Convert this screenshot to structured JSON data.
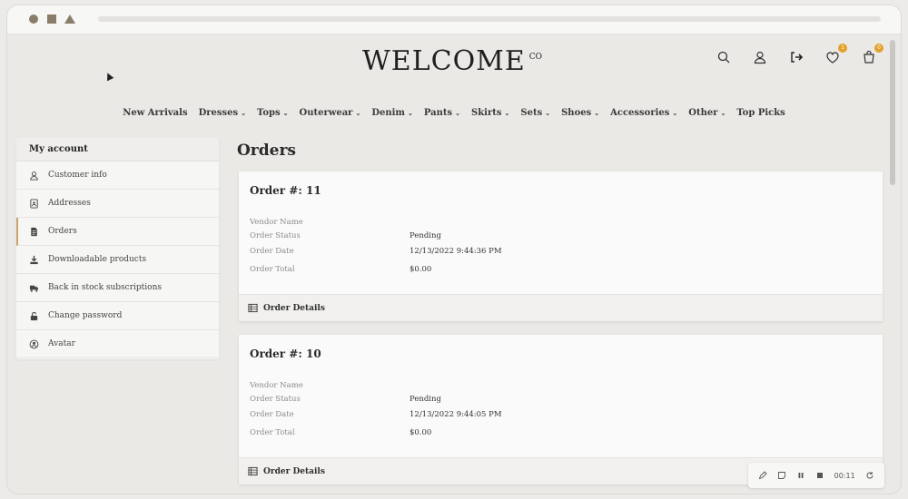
{
  "header": {
    "logo_text": "WELCOME",
    "logo_suffix": "CO",
    "wishlist_count": "1",
    "cart_count": "0"
  },
  "nav": [
    {
      "label": "New Arrivals",
      "chevron": ""
    },
    {
      "label": "Dresses",
      "chevron": "⌄"
    },
    {
      "label": "Tops",
      "chevron": "⌄"
    },
    {
      "label": "Outerwear",
      "chevron": "⌄"
    },
    {
      "label": "Denim",
      "chevron": "⌄"
    },
    {
      "label": "Pants",
      "chevron": "⌄"
    },
    {
      "label": "Skirts",
      "chevron": "⌄"
    },
    {
      "label": "Sets",
      "chevron": "⌄"
    },
    {
      "label": "Shoes",
      "chevron": "⌄"
    },
    {
      "label": "Accessories",
      "chevron": "⌄"
    },
    {
      "label": "Other",
      "chevron": "⌄"
    },
    {
      "label": "Top Picks",
      "chevron": ""
    }
  ],
  "sidebar": {
    "title": "My account",
    "items": [
      {
        "label": "Customer info",
        "icon": "user-icon"
      },
      {
        "label": "Addresses",
        "icon": "address-book-icon"
      },
      {
        "label": "Orders",
        "icon": "document-icon"
      },
      {
        "label": "Downloadable products",
        "icon": "download-icon"
      },
      {
        "label": "Back in stock subscriptions",
        "icon": "truck-icon"
      },
      {
        "label": "Change password",
        "icon": "unlock-icon"
      },
      {
        "label": "Avatar",
        "icon": "user-circle-icon"
      }
    ]
  },
  "main": {
    "title": "Orders",
    "labels": {
      "vendor": "Vendor Name",
      "status": "Order Status",
      "date": "Order Date",
      "total": "Order Total",
      "details": "Order Details"
    },
    "orders": [
      {
        "title": "Order #: 11",
        "vendor": "",
        "status": "Pending",
        "date": "12/13/2022 9:44:36 PM",
        "total": "$0.00"
      },
      {
        "title": "Order #: 10",
        "vendor": "",
        "status": "Pending",
        "date": "12/13/2022 9:44:05 PM",
        "total": "$0.00"
      }
    ]
  },
  "recorder": {
    "time": "00:11"
  },
  "colors": {
    "accent": "#c9a56a",
    "badge": "#e4a02a"
  }
}
